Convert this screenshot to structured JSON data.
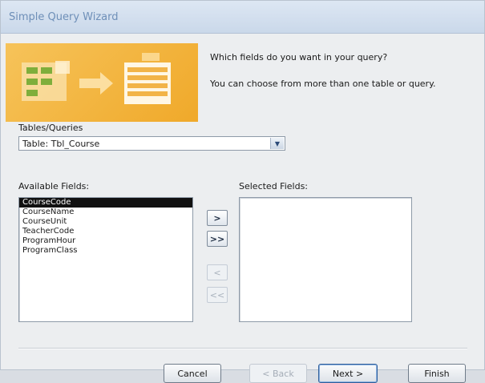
{
  "window": {
    "title": "Simple Query Wizard"
  },
  "intro": {
    "question": "Which fields do you want in your query?",
    "hint": "You can choose from more than one table or query."
  },
  "tables": {
    "label": "Tables/Queries",
    "value": "Table: Tbl_Course"
  },
  "available": {
    "label": "Available Fields:",
    "items": [
      "CourseCode",
      "CourseName",
      "CourseUnit",
      "TeacherCode",
      "ProgramHour",
      "ProgramClass"
    ],
    "selected_item": "CourseCode"
  },
  "selected_fields": {
    "label": "Selected Fields:",
    "items": []
  },
  "move_buttons": {
    "add_one": ">",
    "add_all": ">>",
    "remove_one": "<",
    "remove_all": "<<"
  },
  "footer": {
    "cancel": "Cancel",
    "back": "< Back",
    "next": "Next >",
    "finish": "Finish"
  }
}
